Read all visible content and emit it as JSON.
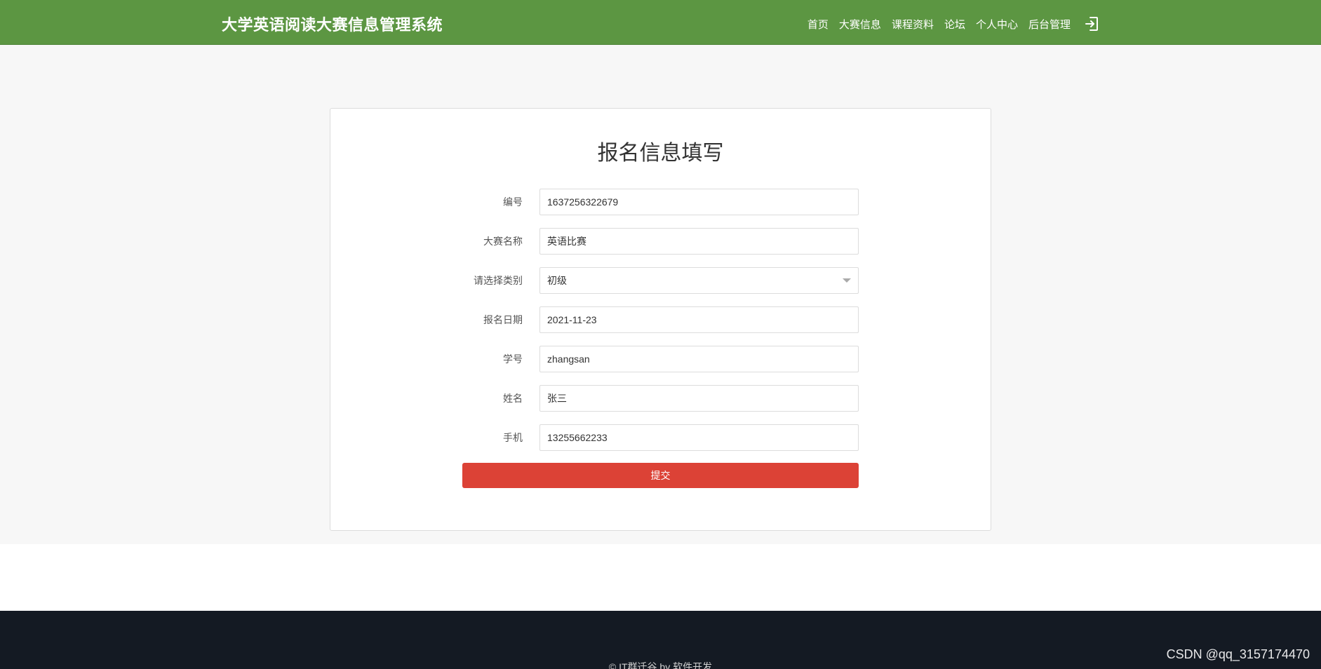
{
  "header": {
    "title": "大学英语阅读大赛信息管理系统",
    "nav": [
      {
        "label": "首页"
      },
      {
        "label": "大赛信息"
      },
      {
        "label": "课程资料"
      },
      {
        "label": "论坛"
      },
      {
        "label": "个人中心"
      },
      {
        "label": "后台管理"
      }
    ],
    "logout_icon": "logout-icon",
    "bg_color": "#5c9642"
  },
  "form": {
    "title": "报名信息填写",
    "fields": [
      {
        "label": "编号",
        "value": "1637256322679"
      },
      {
        "label": "大赛名称",
        "value": "英语比赛"
      },
      {
        "label": "请选择类别",
        "value": "初级"
      },
      {
        "label": "报名日期",
        "value": "2021-11-23"
      },
      {
        "label": "学号",
        "value": "zhangsan"
      },
      {
        "label": "姓名",
        "value": "张三"
      },
      {
        "label": "手机",
        "value": "13255662233"
      }
    ],
    "submit_label": "提交",
    "submit_color": "#dc4236"
  },
  "footer": {
    "text": "© IT群迁谷 by 软件开发"
  },
  "watermark": "CSDN @qq_3157174470"
}
